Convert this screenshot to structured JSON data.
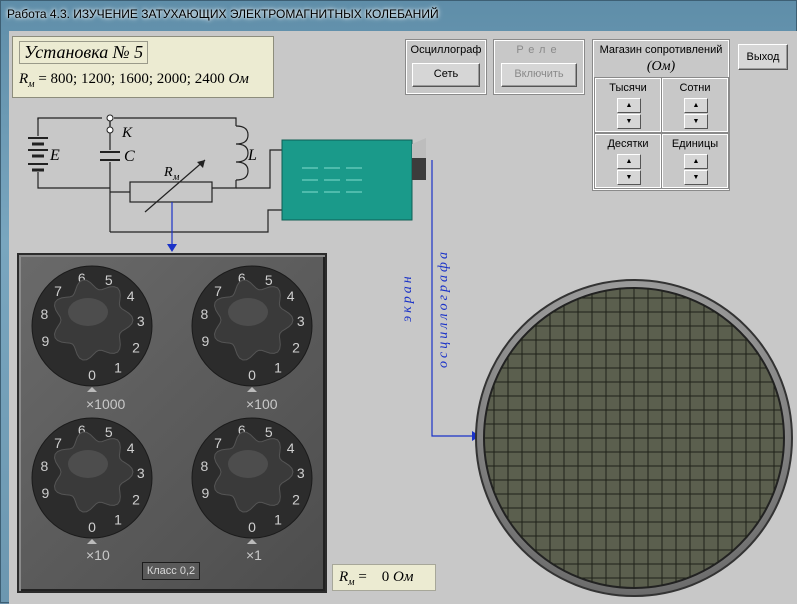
{
  "window": {
    "title": "Работа 4.3. ИЗУЧЕНИЕ ЗАТУХАЮЩИХ ЭЛЕКТРОМАГНИТНЫХ КОЛЕБАНИЙ"
  },
  "setup": {
    "title": "Установка № 5",
    "rm_symbol": "R",
    "rm_sub": "м",
    "values_text": " = 800; 1200; 1600; 2000; 2400 ",
    "unit": "Ом"
  },
  "oscillograph": {
    "label": "Осциллограф",
    "power_button": "Сеть"
  },
  "relay": {
    "label": "Реле",
    "enable_button": "Включить"
  },
  "resistance_box": {
    "title": "Магазин сопротивлений",
    "unit": "(Ом)",
    "cells": [
      {
        "label": "Тысячи"
      },
      {
        "label": "Сотни"
      },
      {
        "label": "Десятки"
      },
      {
        "label": "Единицы"
      }
    ]
  },
  "exit_button": "Выход",
  "circuit": {
    "E": "E",
    "K": "K",
    "C": "C",
    "L": "L",
    "R": "R",
    "R_sub": "м"
  },
  "screen_label": {
    "line1": "экран",
    "line2": "осциллографа"
  },
  "knobs": {
    "digits": [
      "0",
      "1",
      "2",
      "3",
      "4",
      "5",
      "6",
      "7",
      "8",
      "9"
    ],
    "multipliers": [
      "×1000",
      "×100",
      "×10",
      "×1"
    ],
    "positions": [
      0,
      0,
      0,
      0
    ]
  },
  "class_label": "Класс 0,2",
  "reading": {
    "symbol": "R",
    "sub": "м",
    "equals": " = ",
    "value": "0",
    "unit": "Ом"
  },
  "colors": {
    "info_bg": "#ecebd2",
    "oscillograph_body": "#1a9a8a",
    "wire_blue": "#1a32c8",
    "screen_fill": "#5b5f4e"
  }
}
